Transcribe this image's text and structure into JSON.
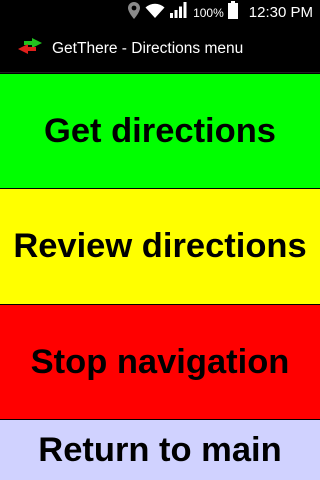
{
  "status_bar": {
    "battery_percent": "100%",
    "time": "12:30 PM",
    "icons": [
      "location-icon",
      "wifi-icon",
      "signal-icon",
      "battery-icon"
    ]
  },
  "action_bar": {
    "app_icon": "arrows-icon",
    "title": "GetThere - Directions menu"
  },
  "menu": {
    "get_directions": "Get directions",
    "review_directions": "Review directions",
    "stop_navigation": "Stop navigation",
    "return_to_main": "Return to main"
  },
  "colors": {
    "get_directions": "#00ff00",
    "review_directions": "#ffff00",
    "stop_navigation": "#ff0000",
    "return_to_main": "#d0d2ff"
  }
}
